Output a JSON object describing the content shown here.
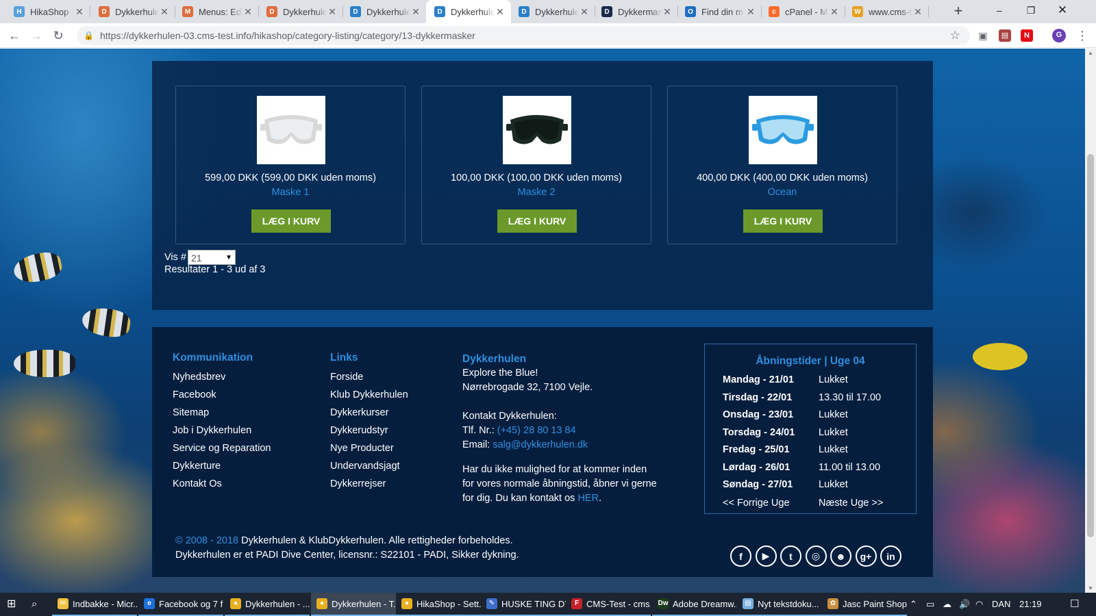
{
  "browser": {
    "tabs": [
      {
        "title": "HikaShop - ",
        "favicon_color": "#5aa0d8",
        "favicon": "H",
        "active": false
      },
      {
        "title": "Dykkerhule",
        "favicon_color": "#e06c3c",
        "favicon": "D",
        "active": false
      },
      {
        "title": "Menus: Edi",
        "favicon_color": "#e06c3c",
        "favicon": "M",
        "active": false
      },
      {
        "title": "Dykkerhule",
        "favicon_color": "#e06c3c",
        "favicon": "D",
        "active": false
      },
      {
        "title": "Dykkerhule",
        "favicon_color": "#2a7fc8",
        "favicon": "D",
        "active": false
      },
      {
        "title": "Dykkerhule",
        "favicon_color": "#2a7fc8",
        "favicon": "D",
        "active": true
      },
      {
        "title": "Dykkerhule",
        "favicon_color": "#2a7fc8",
        "favicon": "D",
        "active": false
      },
      {
        "title": "Dykkermas",
        "favicon_color": "#1a2a4a",
        "favicon": "D",
        "active": false
      },
      {
        "title": "Find din m",
        "favicon_color": "#1f6fc0",
        "favicon": "O",
        "active": false
      },
      {
        "title": "cPanel - M",
        "favicon_color": "#ff6c2c",
        "favicon": "c",
        "active": false
      },
      {
        "title": "www.cms-t",
        "favicon_color": "#e8a020",
        "favicon": "W",
        "active": false
      }
    ],
    "new_tab": "+",
    "url": "https://dykkerhulen-03.cms-test.info/hikashop/category-listing/category/13-dykkermasker",
    "extensions": [
      "camera-icon",
      "pdf-icon",
      "n-icon",
      "profile-g-icon"
    ],
    "profile_letter": "G",
    "ext_n": "N"
  },
  "products": [
    {
      "price": "599,00 DKK (599,00 DKK uden moms)",
      "name": "Maske 1",
      "button": "LÆG I KURV",
      "frame": "#d8d8d8",
      "lens": "#eef2f4"
    },
    {
      "price": "100,00 DKK (100,00 DKK uden moms)",
      "name": "Maske 2",
      "button": "LÆG I KURV",
      "frame": "#1a2a22",
      "lens": "#0f1a16"
    },
    {
      "price": "400,00 DKK (400,00 DKK uden moms)",
      "name": "Ocean",
      "button": "LÆG I KURV",
      "frame": "#2a9be0",
      "lens": "#bfe6f7"
    }
  ],
  "listing": {
    "vis_label": "Vis #",
    "vis_value": "21",
    "results": "Resultater 1 - 3 ud af 3"
  },
  "footer": {
    "kommunikation": {
      "title": "Kommunikation",
      "items": [
        "Nyhedsbrev",
        "Facebook",
        "Sitemap",
        "Job i Dykkerhulen",
        "Service og Reparation",
        "Dykkerture",
        "Kontakt Os"
      ]
    },
    "links": {
      "title": "Links",
      "items": [
        "Forside",
        "Klub Dykkerhulen",
        "Dykkerkurser",
        "Dykkerudstyr",
        "Nye Producter",
        "Undervandsjagt",
        "Dykkerrejser"
      ]
    },
    "about": {
      "title": "Dykkerhulen",
      "tagline": "Explore the Blue!",
      "address": "Nørrebrogade 32, 7100 Vejle.",
      "contact_heading": "Kontakt Dykkerhulen:",
      "phone_label": "Tlf. Nr.: ",
      "phone": "(+45) 28 80 13 84",
      "email_label": "Email: ",
      "email": "salg@dykkerhulen.dk",
      "note_1": "Har du ikke mulighed for at kommer inden",
      "note_2": "for vores normale åbningstid, åbner vi gerne",
      "note_3": "for dig. Du kan kontakt os ",
      "note_link": "HER",
      "note_end": "."
    },
    "hours": {
      "title": "Åbningstider | Uge 04",
      "rows": [
        {
          "day": "Mandag - 21/01",
          "time": "Lukket"
        },
        {
          "day": "Tirsdag - 22/01",
          "time": "13.30 til 17.00"
        },
        {
          "day": "Onsdag - 23/01",
          "time": "Lukket"
        },
        {
          "day": "Torsdag - 24/01",
          "time": "Lukket"
        },
        {
          "day": "Fredag - 25/01",
          "time": "Lukket"
        },
        {
          "day": "Lørdag - 26/01",
          "time": "11.00 til 13.00"
        },
        {
          "day": "Søndag - 27/01",
          "time": "Lukket"
        }
      ],
      "prev": "<< Forrige Uge",
      "next": "Næste Uge >>"
    },
    "copyright_years": "© 2008 - 2018",
    "copyright_text": " Dykkerhulen & KlubDykkerhulen. Alle rettigheder forbeholdes.",
    "padi_text": "Dykkerhulen er et PADI Dive Center, licensnr.: S22101 - PADI, Sikker dykning.",
    "social": [
      {
        "name": "facebook-icon",
        "glyph": "f"
      },
      {
        "name": "youtube-icon",
        "glyph": "▶"
      },
      {
        "name": "twitter-icon",
        "glyph": "t"
      },
      {
        "name": "instagram-icon",
        "glyph": "◎"
      },
      {
        "name": "community-icon",
        "glyph": "☻"
      },
      {
        "name": "google-plus-icon",
        "glyph": "g+"
      },
      {
        "name": "linkedin-icon",
        "glyph": "in"
      }
    ]
  },
  "taskbar": {
    "items": [
      {
        "label": "Indbakke - Micr...",
        "color": "#f0c040",
        "glyph": "✉"
      },
      {
        "label": "Facebook og 7 f...",
        "color": "#1e6fd9",
        "glyph": "e"
      },
      {
        "label": "Dykkerhulen - ...",
        "color": "#e8b020",
        "glyph": "●"
      },
      {
        "label": "Dykkerhulen - T...",
        "color": "#e8b020",
        "glyph": "●"
      },
      {
        "label": "HikaShop - Sett...",
        "color": "#e8b020",
        "glyph": "●"
      },
      {
        "label": "HUSKE TING DY...",
        "color": "#3d6fc8",
        "glyph": "✎"
      },
      {
        "label": "CMS-Test - cms...",
        "color": "#c8202a",
        "glyph": "F"
      },
      {
        "label": "Adobe Dreamw...",
        "color": "#1c3a1c",
        "glyph": "Dw"
      },
      {
        "label": "Nyt tekstdoku...",
        "color": "#7ab0e0",
        "glyph": "▤"
      },
      {
        "label": "Jasc Paint Shop...",
        "color": "#c89040",
        "glyph": "✿"
      }
    ],
    "lang": "DAN",
    "time": "21:19"
  },
  "colors": {
    "accent_blue": "#2f8fe0",
    "cart_green": "#6b9a2a",
    "panel_navy": "#061e3e"
  }
}
